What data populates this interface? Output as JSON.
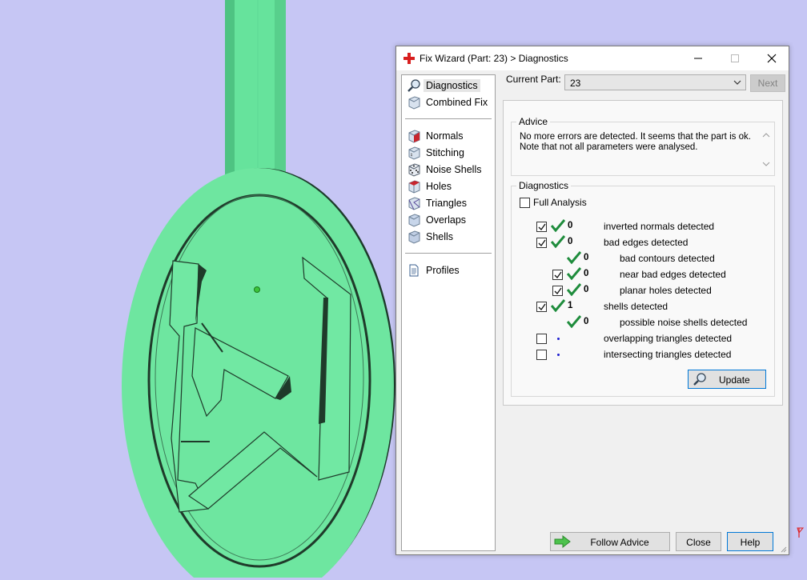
{
  "window": {
    "title": "Fix Wizard (Part: 23) > Diagnostics",
    "icon": "red-cross-icon"
  },
  "nav": {
    "items": [
      {
        "label": "Diagnostics",
        "icon": "magnifier-icon",
        "selected": true
      },
      {
        "label": "Combined Fix",
        "icon": "cube-icon"
      },
      {
        "label": "Normals",
        "icon": "cube-red-face-icon"
      },
      {
        "label": "Stitching",
        "icon": "cube-stitch-icon"
      },
      {
        "label": "Noise Shells",
        "icon": "dice-icon"
      },
      {
        "label": "Holes",
        "icon": "cube-hole-icon"
      },
      {
        "label": "Triangles",
        "icon": "triangle-cube-icon"
      },
      {
        "label": "Overlaps",
        "icon": "overlap-cube-icon"
      },
      {
        "label": "Shells",
        "icon": "shells-cube-icon"
      },
      {
        "label": "Profiles",
        "icon": "document-icon"
      }
    ]
  },
  "current_part": {
    "label": "Current Part:",
    "value": "23",
    "next_label": "Next"
  },
  "advice": {
    "title": "Advice",
    "lines": [
      "No more errors are detected. It seems that the part is ok.",
      "Note that not all parameters were analysed."
    ]
  },
  "diagnostics": {
    "title": "Diagnostics",
    "full_analysis_label": "Full Analysis",
    "full_analysis_checked": false,
    "rows": [
      {
        "checkbox": true,
        "checked": true,
        "status": "ok",
        "count": "0",
        "label": "inverted normals detected",
        "indent": 0
      },
      {
        "checkbox": true,
        "checked": true,
        "status": "ok",
        "count": "0",
        "label": "bad edges detected",
        "indent": 0
      },
      {
        "checkbox": false,
        "checked": false,
        "status": "ok",
        "count": "0",
        "label": "bad contours detected",
        "indent": 1
      },
      {
        "checkbox": true,
        "checked": true,
        "status": "ok",
        "count": "0",
        "label": "near bad edges detected",
        "indent": 1
      },
      {
        "checkbox": true,
        "checked": true,
        "status": "ok",
        "count": "0",
        "label": "planar holes detected",
        "indent": 1
      },
      {
        "checkbox": true,
        "checked": true,
        "status": "ok",
        "count": "1",
        "label": "shells detected",
        "indent": 0
      },
      {
        "checkbox": false,
        "checked": false,
        "status": "ok",
        "count": "0",
        "label": "possible noise shells detected",
        "indent": 1
      },
      {
        "checkbox": true,
        "checked": false,
        "status": "pending",
        "count": "",
        "label": "overlapping triangles detected",
        "indent": 0
      },
      {
        "checkbox": true,
        "checked": false,
        "status": "pending",
        "count": "",
        "label": "intersecting triangles detected",
        "indent": 0
      }
    ],
    "update_label": "Update"
  },
  "buttons": {
    "follow_advice": "Follow Advice",
    "close": "Close",
    "help": "Help"
  },
  "colors": {
    "viewport_bg": "#c6c6f4",
    "model_green": "#6ee6a0",
    "check_green": "#1e8c3c",
    "accent_blue": "#0078d7"
  }
}
